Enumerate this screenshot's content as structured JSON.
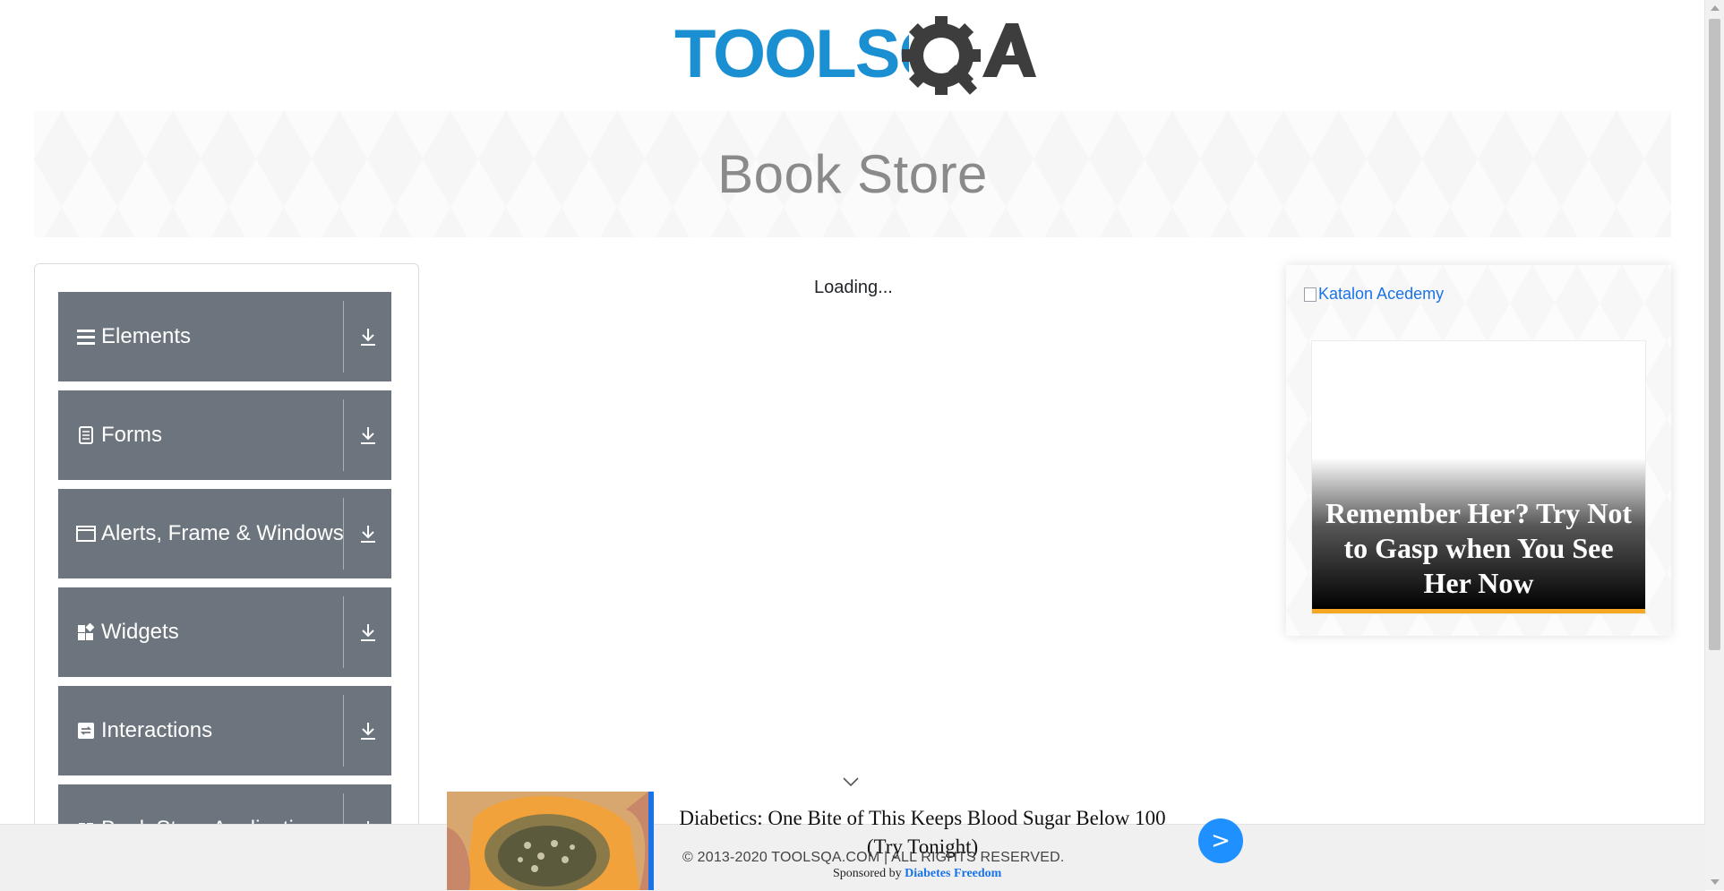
{
  "header": {
    "logo_text": "TOOLSQA"
  },
  "banner": {
    "title": "Book Store"
  },
  "sidebar": {
    "groups": [
      {
        "label": "Elements",
        "icon": "hamburger-icon"
      },
      {
        "label": "Forms",
        "icon": "document-icon"
      },
      {
        "label": "Alerts, Frame & Windows",
        "icon": "window-icon"
      },
      {
        "label": "Widgets",
        "icon": "widgets-icon"
      },
      {
        "label": "Interactions",
        "icon": "interactions-icon"
      },
      {
        "label": "Book Store Application",
        "icon": "book-icon"
      }
    ]
  },
  "main": {
    "loading_text": "Loading..."
  },
  "right_ad": {
    "katalon_alt": "Katalon Acedemy",
    "headline": "Remember Her? Try Not to Gasp when You See Her Now"
  },
  "bottom_ad": {
    "headline": "Diabetics: One Bite of This Keeps Blood Sugar Below 100 (Try Tonight)",
    "sponsored_by": "Sponsored by",
    "sponsor": "Diabetes Freedom",
    "button_label": ">"
  },
  "footer": {
    "copyright": "© 2013-2020 TOOLSQA.COM | ALL RIGHTS RESERVED."
  },
  "colors": {
    "accent_blue": "#1a8fd1",
    "logo_gray": "#3d3d3d",
    "sidebar_gray": "#6c757d",
    "sponsor_blue": "#1a73e8",
    "ad_orange": "#f5a623"
  }
}
